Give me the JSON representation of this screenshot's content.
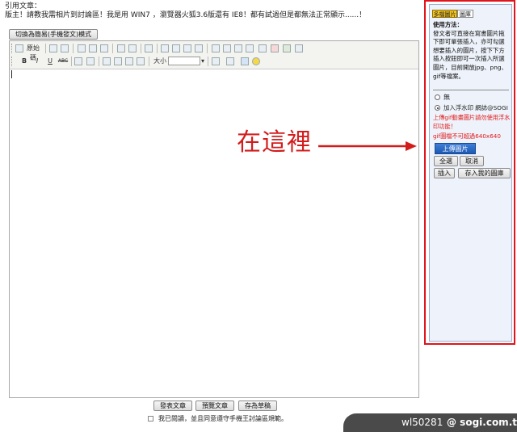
{
  "post": {
    "quote_label": "引用文章：",
    "quote_text": "版主！請教我需相片到討論區！我是用 WIN7 ，瀏覽器火狐3.6版還有 IE8！都有試過但是都無法正常顯示......！"
  },
  "mode_toggle": {
    "label": "切換為簡易(手機發文)模式"
  },
  "toolbar": {
    "source_label": "原始碼",
    "font_size_label": "大小",
    "bold": "B",
    "italic": "I",
    "underline": "U",
    "strike": "ABC"
  },
  "side_panel": {
    "tabs": [
      "多檔圖片",
      "圖庫"
    ],
    "usage_title": "使用方法：",
    "usage_text": "發文者可直接在寫書圖片拖下即可單張插入，亦可勾選想要插入的圖片，按下下方插入按鈕即可一次插入所選圖片，目前開放jpg、png、gif等檔案。",
    "options": [
      {
        "label": "無",
        "selected": false
      },
      {
        "label": "加入浮水印 網誌@SOGI",
        "selected": true
      }
    ],
    "notice_1": "上傳gif動畫圖片請勿使用浮水印功能！",
    "notice_2": "gif圖檔不可超過640x640",
    "upload_button": "上傳圖片",
    "select_all_button": "全選",
    "cancel_button": "取消",
    "insert_button": "插入",
    "save_to_gallery_button": "存入我的圖庫"
  },
  "annotation": {
    "text": "在這裡",
    "color": "#d21c1c"
  },
  "actions": {
    "publish": "發表文章",
    "preview": "預覽文章",
    "save_draft": "存為草稿"
  },
  "agreement": {
    "text": "我已閱讀，並且同意遵守手機王討論區規範。"
  },
  "watermark": {
    "user": "wl50281",
    "site": "@ sogi.com.tw"
  }
}
